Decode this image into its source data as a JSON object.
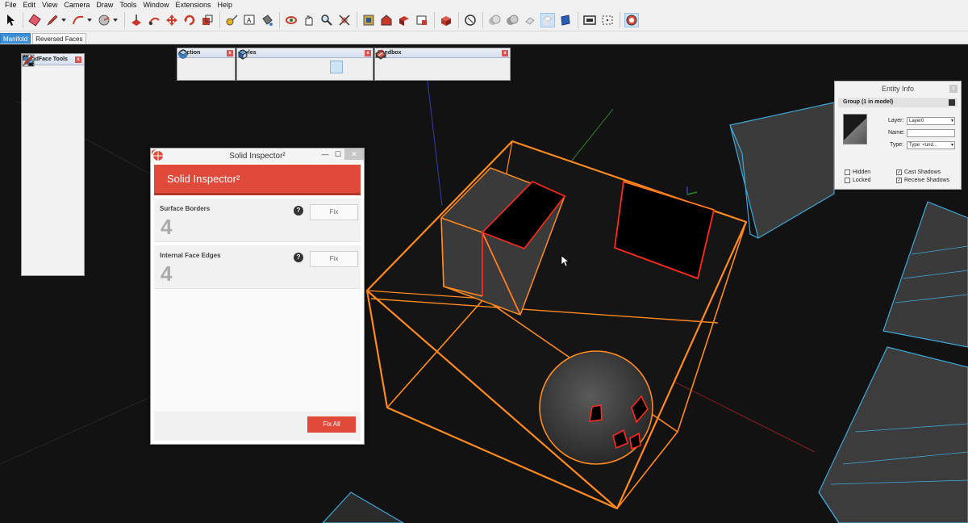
{
  "menu": [
    "File",
    "Edit",
    "View",
    "Camera",
    "Draw",
    "Tools",
    "Window",
    "Extensions",
    "Help"
  ],
  "scene_tabs": [
    "Manifold",
    "Reversed Faces"
  ],
  "floating_toolbars": {
    "section": "Section",
    "styles": "Styles",
    "sandbox": "Sandbox",
    "quadface": "QuadFace Tools",
    "close_glyph": "x"
  },
  "solid_inspector": {
    "window_title": "Solid Inspector²",
    "window_controls": [
      "—",
      "☐",
      "✕"
    ],
    "banner": "Solid Inspector²",
    "sections": [
      {
        "label": "Surface Borders",
        "count": "4",
        "help": "?",
        "fix": "Fix"
      },
      {
        "label": "Internal Face Edges",
        "count": "4",
        "help": "?",
        "fix": "Fix"
      }
    ],
    "fix_all": "Fix All"
  },
  "entity_info": {
    "title": "Entity Info",
    "close": "x",
    "group": "Group (1 in model)",
    "layer_label": "Layer:",
    "layer_value": "Layer0",
    "name_label": "Name:",
    "name_value": "",
    "type_label": "Type:",
    "type_value": "Type: <und...",
    "hidden": "Hidden",
    "locked": "Locked",
    "cast_shadows": "Cast Shadows",
    "receive_shadows": "Receive Shadows",
    "check_mark": "✓"
  },
  "colors": {
    "accent_red": "#e04a3b",
    "selection_orange": "#ff8a1e",
    "viewport_bg": "#121212",
    "wire_blue": "#3ea8d8",
    "error_red": "#ff2a1a"
  }
}
